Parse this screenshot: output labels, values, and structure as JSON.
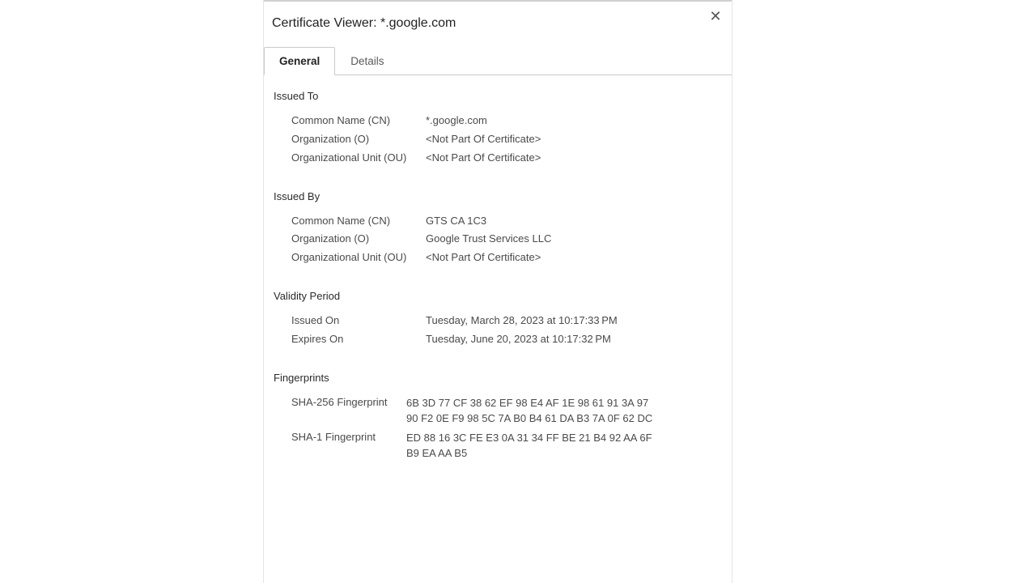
{
  "header": {
    "title": "Certificate Viewer: *.google.com"
  },
  "tabs": {
    "general": "General",
    "details": "Details"
  },
  "sections": {
    "issuedTo": {
      "title": "Issued To",
      "cnLabel": "Common Name (CN)",
      "cnValue": "*.google.com",
      "oLabel": "Organization (O)",
      "oValue": "<Not Part Of Certificate>",
      "ouLabel": "Organizational Unit (OU)",
      "ouValue": "<Not Part Of Certificate>"
    },
    "issuedBy": {
      "title": "Issued By",
      "cnLabel": "Common Name (CN)",
      "cnValue": "GTS CA 1C3",
      "oLabel": "Organization (O)",
      "oValue": "Google Trust Services LLC",
      "ouLabel": "Organizational Unit (OU)",
      "ouValue": "<Not Part Of Certificate>"
    },
    "validity": {
      "title": "Validity Period",
      "issuedOnLabel": "Issued On",
      "issuedOnValue": "Tuesday, March 28, 2023 at 10:17:33 PM",
      "expiresOnLabel": "Expires On",
      "expiresOnValue": "Tuesday, June 20, 2023 at 10:17:32 PM"
    },
    "fingerprints": {
      "title": "Fingerprints",
      "sha256Label": "SHA-256 Fingerprint",
      "sha256Line1": "6B 3D 77 CF 38 62 EF 98 E4 AF 1E 98 61 91 3A 97",
      "sha256Line2": "90 F2 0E F9 98 5C 7A B0 B4 61 DA B3 7A 0F 62 DC",
      "sha1Label": "SHA-1 Fingerprint",
      "sha1Line1": "ED 88 16 3C FE E3 0A 31 34 FF BE 21 B4 92 AA 6F",
      "sha1Line2": "B9 EA AA B5"
    }
  }
}
